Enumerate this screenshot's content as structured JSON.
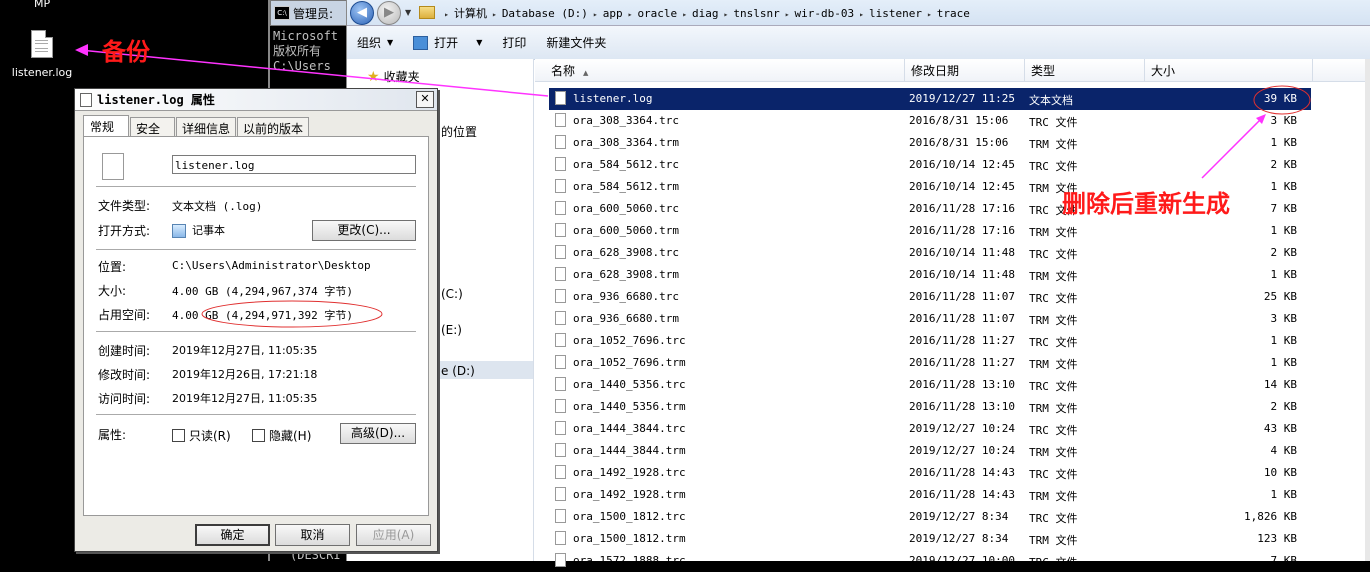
{
  "desktop": {
    "top_label": "MP",
    "icon_label": "listener.log"
  },
  "cmd": {
    "title": "管理员:",
    "lines": [
      "Microsoft",
      "版权所有",
      "",
      "C:\\Users"
    ],
    "bottom_text": "(DESCRI"
  },
  "explorer": {
    "breadcrumb": [
      "计算机",
      "Database (D:)",
      "app",
      "oracle",
      "diag",
      "tnslsnr",
      "wir-db-03",
      "listener",
      "trace"
    ],
    "toolbar": {
      "organize": "组织",
      "open": "打开",
      "print": "打印",
      "new_folder": "新建文件夹"
    },
    "nav": {
      "favorites": "收藏夹",
      "recent_places": "的位置",
      "drive_c": "(C:)",
      "drive_d": "e (D:)",
      "drive_e": "(E:)"
    },
    "columns": {
      "name": "名称",
      "modified": "修改日期",
      "type": "类型",
      "size": "大小"
    },
    "files": [
      {
        "name": "listener.log",
        "date": "2019/12/27 11:25",
        "type": "文本文档",
        "size": "39 KB",
        "selected": true
      },
      {
        "name": "ora_308_3364.trc",
        "date": "2016/8/31 15:06",
        "type": "TRC 文件",
        "size": "3 KB"
      },
      {
        "name": "ora_308_3364.trm",
        "date": "2016/8/31 15:06",
        "type": "TRM 文件",
        "size": "1 KB"
      },
      {
        "name": "ora_584_5612.trc",
        "date": "2016/10/14 12:45",
        "type": "TRC 文件",
        "size": "2 KB"
      },
      {
        "name": "ora_584_5612.trm",
        "date": "2016/10/14 12:45",
        "type": "TRM 文件",
        "size": "1 KB"
      },
      {
        "name": "ora_600_5060.trc",
        "date": "2016/11/28 17:16",
        "type": "TRC 文件",
        "size": "7 KB"
      },
      {
        "name": "ora_600_5060.trm",
        "date": "2016/11/28 17:16",
        "type": "TRM 文件",
        "size": "1 KB"
      },
      {
        "name": "ora_628_3908.trc",
        "date": "2016/10/14 11:48",
        "type": "TRC 文件",
        "size": "2 KB"
      },
      {
        "name": "ora_628_3908.trm",
        "date": "2016/10/14 11:48",
        "type": "TRM 文件",
        "size": "1 KB"
      },
      {
        "name": "ora_936_6680.trc",
        "date": "2016/11/28 11:07",
        "type": "TRC 文件",
        "size": "25 KB"
      },
      {
        "name": "ora_936_6680.trm",
        "date": "2016/11/28 11:07",
        "type": "TRM 文件",
        "size": "3 KB"
      },
      {
        "name": "ora_1052_7696.trc",
        "date": "2016/11/28 11:27",
        "type": "TRC 文件",
        "size": "1 KB"
      },
      {
        "name": "ora_1052_7696.trm",
        "date": "2016/11/28 11:27",
        "type": "TRM 文件",
        "size": "1 KB"
      },
      {
        "name": "ora_1440_5356.trc",
        "date": "2016/11/28 13:10",
        "type": "TRC 文件",
        "size": "14 KB"
      },
      {
        "name": "ora_1440_5356.trm",
        "date": "2016/11/28 13:10",
        "type": "TRM 文件",
        "size": "2 KB"
      },
      {
        "name": "ora_1444_3844.trc",
        "date": "2019/12/27 10:24",
        "type": "TRC 文件",
        "size": "43 KB"
      },
      {
        "name": "ora_1444_3844.trm",
        "date": "2019/12/27 10:24",
        "type": "TRM 文件",
        "size": "4 KB"
      },
      {
        "name": "ora_1492_1928.trc",
        "date": "2016/11/28 14:43",
        "type": "TRC 文件",
        "size": "10 KB"
      },
      {
        "name": "ora_1492_1928.trm",
        "date": "2016/11/28 14:43",
        "type": "TRM 文件",
        "size": "1 KB"
      },
      {
        "name": "ora_1500_1812.trc",
        "date": "2019/12/27 8:34",
        "type": "TRC 文件",
        "size": "1,826 KB"
      },
      {
        "name": "ora_1500_1812.trm",
        "date": "2019/12/27 8:34",
        "type": "TRM 文件",
        "size": "123 KB"
      },
      {
        "name": "ora_1572_1888.trc",
        "date": "2019/12/27 10:00",
        "type": "TRC 文件",
        "size": "7 KB"
      }
    ]
  },
  "props": {
    "title": "listener.log 属性",
    "close": "✕",
    "tabs": [
      "常规",
      "安全",
      "详细信息",
      "以前的版本"
    ],
    "filename": "listener.log",
    "file_type_label": "文件类型:",
    "file_type": "文本文档 (.log)",
    "open_with_label": "打开方式:",
    "open_with": "记事本",
    "change_button": "更改(C)...",
    "location_label": "位置:",
    "location": "C:\\Users\\Administrator\\Desktop",
    "size_label": "大小:",
    "size": "4.00 GB (4,294,967,374 字节)",
    "size_on_disk_label": "占用空间:",
    "size_on_disk": "4.00 GB (4,294,971,392 字节)",
    "created_label": "创建时间:",
    "created": "2019年12月27日, 11:05:35",
    "modified_label": "修改时间:",
    "modified": "2019年12月26日, 17:21:18",
    "accessed_label": "访问时间:",
    "accessed": "2019年12月27日, 11:05:35",
    "attributes_label": "属性:",
    "readonly": "只读(R)",
    "hidden": "隐藏(H)",
    "advanced_button": "高级(D)...",
    "ok": "确定",
    "cancel": "取消",
    "apply": "应用(A)"
  },
  "annotations": {
    "backup": "备份",
    "regenerated": "删除后重新生成",
    "color": "#ff1a1a",
    "arrow_color": "#ff33ff"
  }
}
